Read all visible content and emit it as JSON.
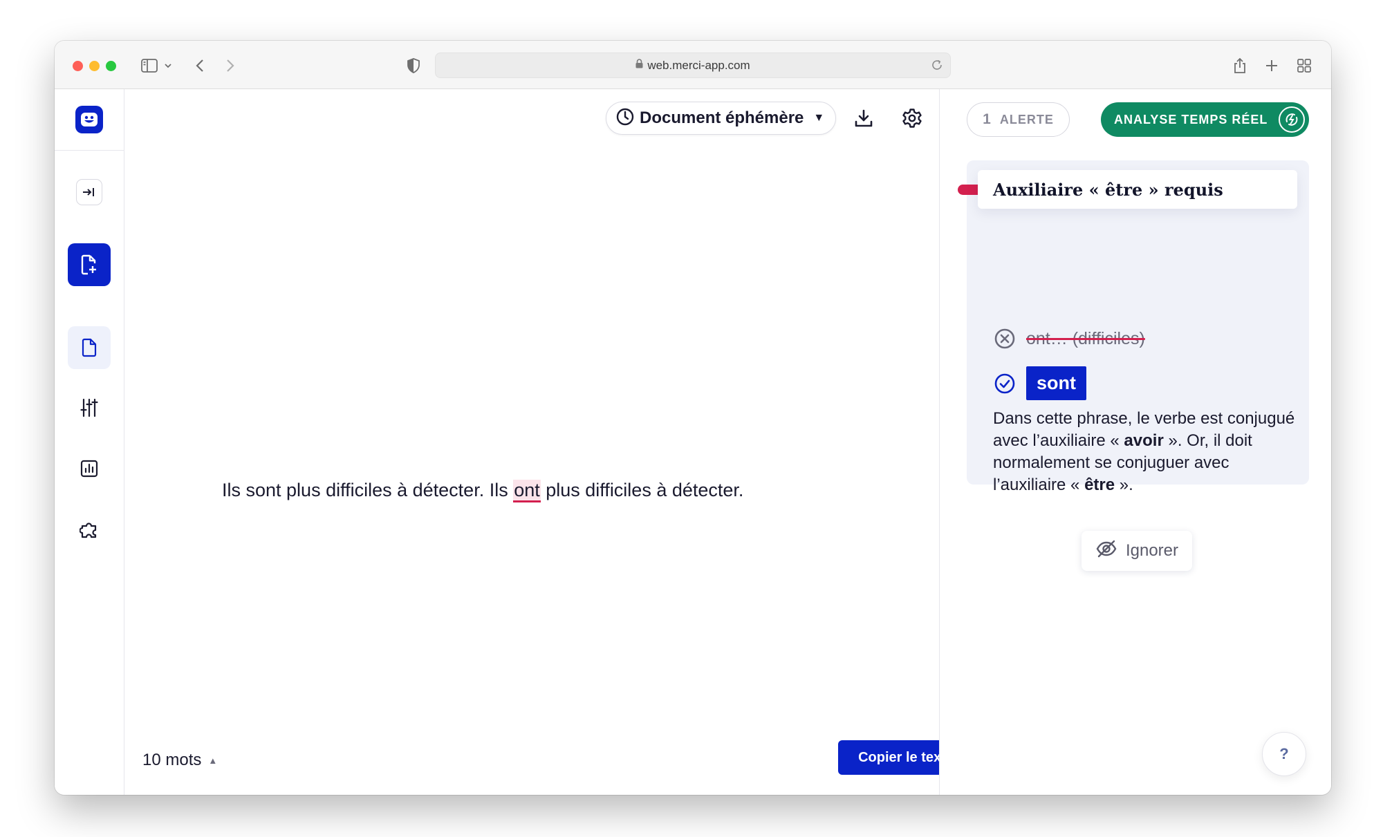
{
  "browser": {
    "url": "web.merci-app.com",
    "icons": [
      "sidebar-icon",
      "chevron-down-icon",
      "back-icon",
      "forward-icon",
      "shield-icon",
      "lock-icon",
      "reload-icon",
      "share-icon",
      "plus-icon",
      "grid-icon"
    ]
  },
  "leftnav": {
    "icons": [
      "merci-logo",
      "collapse-icon",
      "new-document-icon",
      "document-icon",
      "sliders-icon",
      "chart-icon",
      "puzzle-icon"
    ]
  },
  "editor": {
    "doc_selector_label": "Document éphémère",
    "doc_selector_caret": "▼",
    "text_before": "Ils sont plus difficiles à détecter. Ils ",
    "text_error": "ont",
    "text_after": " plus difficiles à détecter.",
    "word_count": "10 mots",
    "word_count_toggle": "▲",
    "copy_button": "Copier le texte"
  },
  "panel": {
    "alert_count": "1",
    "alert_label": "ALERTE",
    "realtime_button": "ANALYSE TEMPS RÉEL",
    "card_title": "Auxiliaire « être » requis",
    "wrong_option": "ont… (difficiles)",
    "suggestion": "sont",
    "explanation": {
      "p1": "Dans cette phrase, le verbe est conjugué avec l’auxiliaire « ",
      "p1_bold": "avoir",
      "p1_end": " ». Or, il doit normalement se conjuguer avec l’auxiliaire « ",
      "p2_bold": "être",
      "p2_end": " »."
    },
    "ignore_button": "Ignorer",
    "help_button": "?"
  },
  "colors": {
    "brand_blue": "#0a23c8",
    "realtime_green": "#0f8a62",
    "error_red": "#d3204e"
  }
}
